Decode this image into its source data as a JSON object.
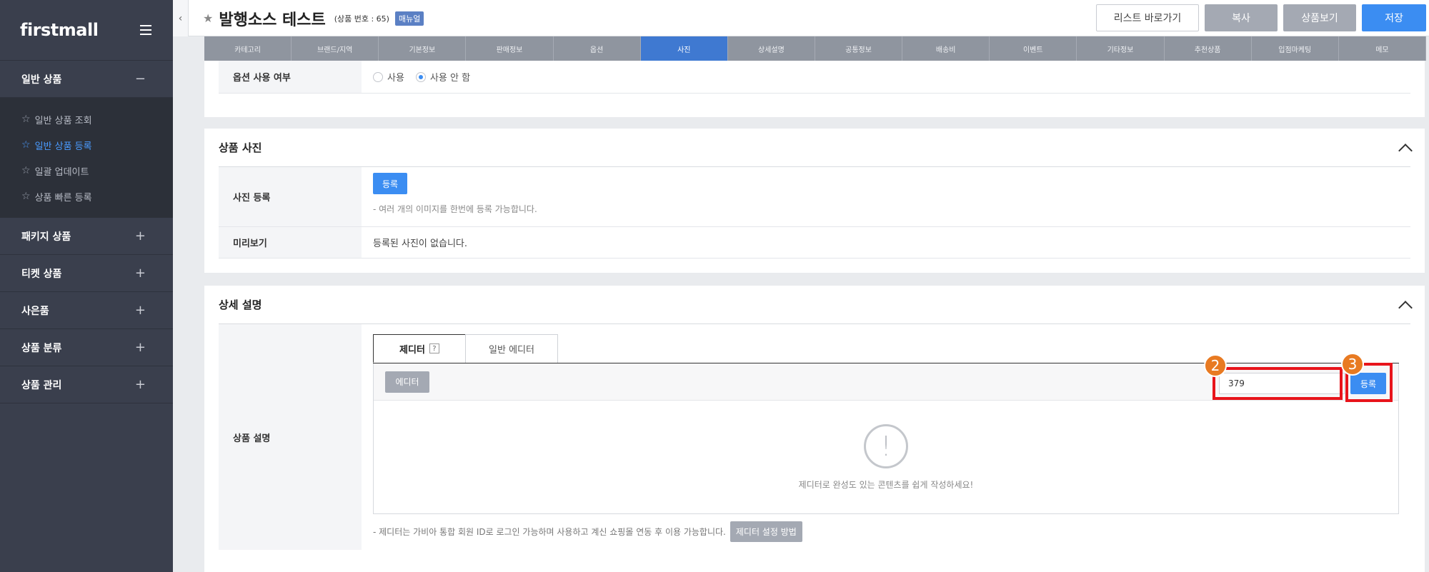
{
  "sidebar": {
    "logo": "firstmall",
    "sections": [
      {
        "label": "일반 상품",
        "toggle": "−",
        "expanded": true,
        "items": [
          {
            "label": "일반 상품 조회",
            "active": false
          },
          {
            "label": "일반 상품 등록",
            "active": true
          },
          {
            "label": "일괄 업데이트",
            "active": false
          },
          {
            "label": "상품 빠른 등록",
            "active": false
          }
        ]
      },
      {
        "label": "패키지 상품",
        "toggle": "+"
      },
      {
        "label": "티켓 상품",
        "toggle": "+"
      },
      {
        "label": "사은품",
        "toggle": "+"
      },
      {
        "label": "상품 분류",
        "toggle": "+"
      },
      {
        "label": "상품 관리",
        "toggle": "+"
      }
    ]
  },
  "header": {
    "title": "발행소스 테스트",
    "product_no": "(상품 번호 : 65)",
    "badge": "매뉴얼",
    "actions": {
      "list": "리스트 바로가기",
      "copy": "복사",
      "view": "상품보기",
      "save": "저장"
    }
  },
  "tabs": [
    "카테고리",
    "브랜드/지역",
    "기본정보",
    "판매정보",
    "옵션",
    "사진",
    "상세설명",
    "공통정보",
    "배송비",
    "이벤트",
    "기타정보",
    "추천상품",
    "입점마케팅",
    "메모"
  ],
  "active_tab_index": 5,
  "option_panel": {
    "label": "옵션 사용 여부",
    "radio_use": "사용",
    "radio_no_use": "사용 안 함",
    "selected": "사용 안 함"
  },
  "photo_panel": {
    "title": "상품 사진",
    "register_label": "사진 등록",
    "register_button": "등록",
    "register_note": "- 여러 개의 이미지를 한번에 등록 가능합니다.",
    "preview_label": "미리보기",
    "preview_text": "등록된 사진이 없습니다."
  },
  "detail_panel": {
    "title": "상세 설명",
    "row_label": "상품 설명",
    "tab_editor": "제디터",
    "tab_help": "?",
    "tab_general": "일반 에디터",
    "editor_button": "에디터",
    "input_value": "379",
    "register_button": "등록",
    "empty_icon": "!",
    "empty_message": "제디터로 완성도 있는 콘텐츠를 쉽게 작성하세요!",
    "footer_note": "- 제디터는 가비아 통합 회원 ID로 로그인 가능하며 사용하고 계신 쇼핑몰 연동 후 이용 가능합니다.",
    "guide_button": "제디터 설정 방법"
  },
  "annotations": {
    "step2": "2",
    "step3": "3"
  },
  "colors": {
    "accent": "#3b8df2",
    "highlight": "#e8141b",
    "step_badge": "#e87a22",
    "sidebar": "#3a3f4d"
  }
}
